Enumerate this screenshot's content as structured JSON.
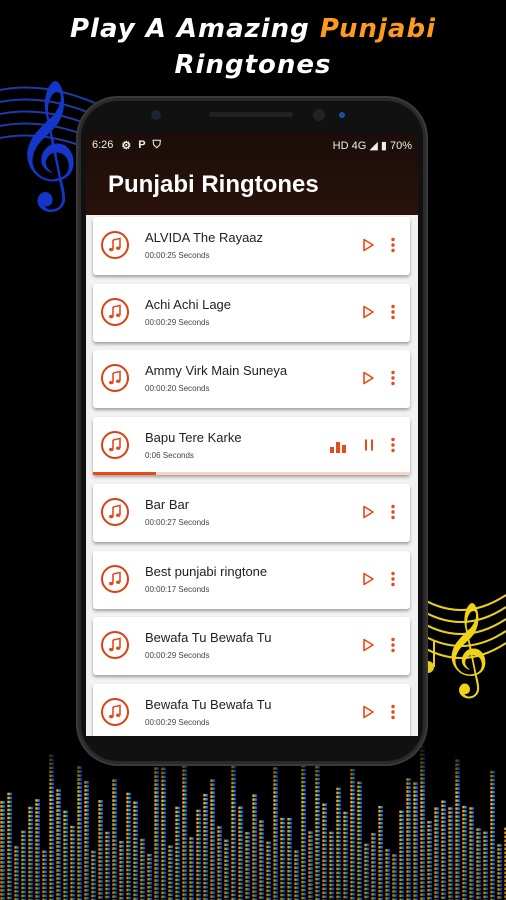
{
  "headline": {
    "line1_prefix": "Play A Amazing ",
    "line1_highlight": "Punjabi",
    "line2": "Ringtones"
  },
  "status_bar": {
    "time": "6:26",
    "icons_left": [
      "gear-icon",
      "p-icon",
      "shield-icon"
    ],
    "right_text": "HD 4G ◢ ▮ 70%"
  },
  "app": {
    "title": "Punjabi Ringtones"
  },
  "accent_color": "#e64a19",
  "ringtones": [
    {
      "title": "ALVIDA The Rayaaz",
      "duration": "00:00:25 Seconds",
      "state": "idle"
    },
    {
      "title": "Achi Achi Lage",
      "duration": "00:00:29 Seconds",
      "state": "idle"
    },
    {
      "title": "Ammy Virk Main Suneya",
      "duration": "00:00:20 Seconds",
      "state": "idle"
    },
    {
      "title": "Bapu Tere Karke",
      "duration": "0:06 Seconds",
      "state": "playing",
      "progress": 0.2
    },
    {
      "title": "Bar Bar",
      "duration": "00:00:27 Seconds",
      "state": "idle"
    },
    {
      "title": "Best punjabi ringtone",
      "duration": "00:00:17 Seconds",
      "state": "idle"
    },
    {
      "title": "Bewafa Tu Bewafa Tu",
      "duration": "00:00:29 Seconds",
      "state": "idle"
    },
    {
      "title": "Bewafa Tu Bewafa Tu",
      "duration": "00:00:29 Seconds",
      "state": "idle"
    }
  ]
}
